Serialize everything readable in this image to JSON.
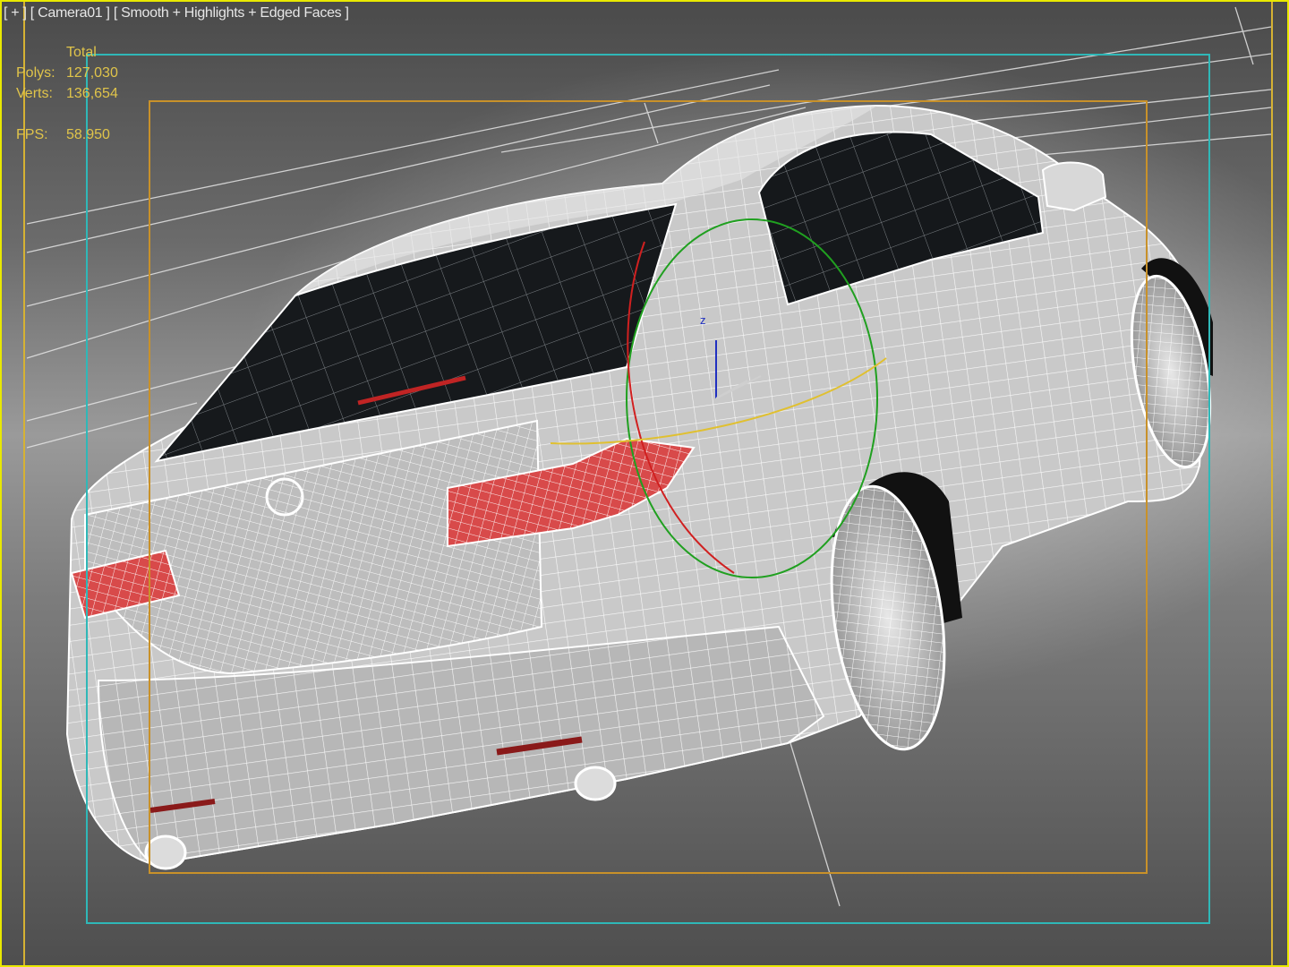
{
  "viewport": {
    "label_menu": "[ + ]",
    "label_camera": "[ Camera01 ]",
    "label_shading": "[ Smooth + Highlights + Edged Faces ]"
  },
  "stats": {
    "header": "Total",
    "polys_label": "Polys:",
    "polys_value": "127,030",
    "verts_label": "Verts:",
    "verts_value": "136,654",
    "fps_label": "FPS:",
    "fps_value": "58.950"
  },
  "colors": {
    "active_viewport_border": "#e8e800",
    "stats_text": "#e0c44a",
    "safe_frame_action": "#2fb8b8",
    "safe_frame_title": "#c8912a",
    "gizmo_x": "#d02020",
    "gizmo_y": "#20a020",
    "gizmo_z": "#2030c0",
    "gizmo_ring_yellow": "#e0c030"
  },
  "scene": {
    "object": "car-wireframe-model",
    "camera_gizmo_axis_label": "z"
  }
}
